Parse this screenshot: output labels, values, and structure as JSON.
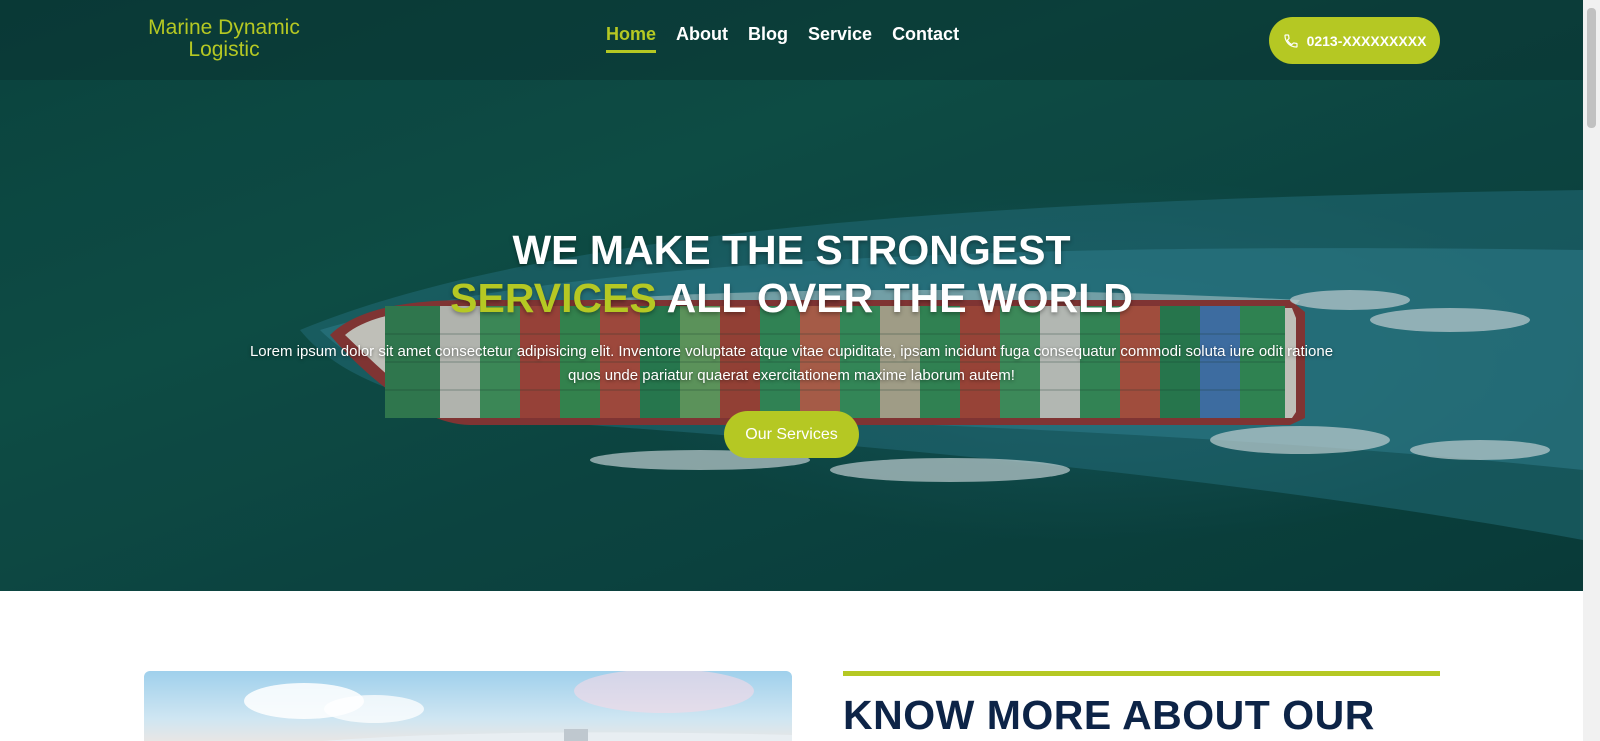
{
  "brand": {
    "name": "Marine Dynamic Logistic",
    "accent_color": "#b5c823",
    "heading_color": "#0d2447"
  },
  "nav": {
    "items": [
      {
        "label": "Home",
        "active": true
      },
      {
        "label": "About",
        "active": false
      },
      {
        "label": "Blog",
        "active": false
      },
      {
        "label": "Service",
        "active": false
      },
      {
        "label": "Contact",
        "active": false
      }
    ],
    "phone_label": "0213-XXXXXXXXX",
    "phone_icon": "phone-icon"
  },
  "hero": {
    "title_line1": "WE MAKE THE STRONGEST",
    "title_accent": "SERVICES",
    "title_line2_rest": " ALL OVER THE WORLD",
    "description": "Lorem ipsum dolor sit amet consectetur adipisicing elit. Inventore voluptate atque vitae cupiditate, ipsam incidunt fuga consequatur commodi soluta iure odit ratione quos unde pariatur quaerat exercitationem maxime laborum autem!",
    "cta_label": "Our Services"
  },
  "about": {
    "heading": "KNOW MORE ABOUT OUR"
  }
}
